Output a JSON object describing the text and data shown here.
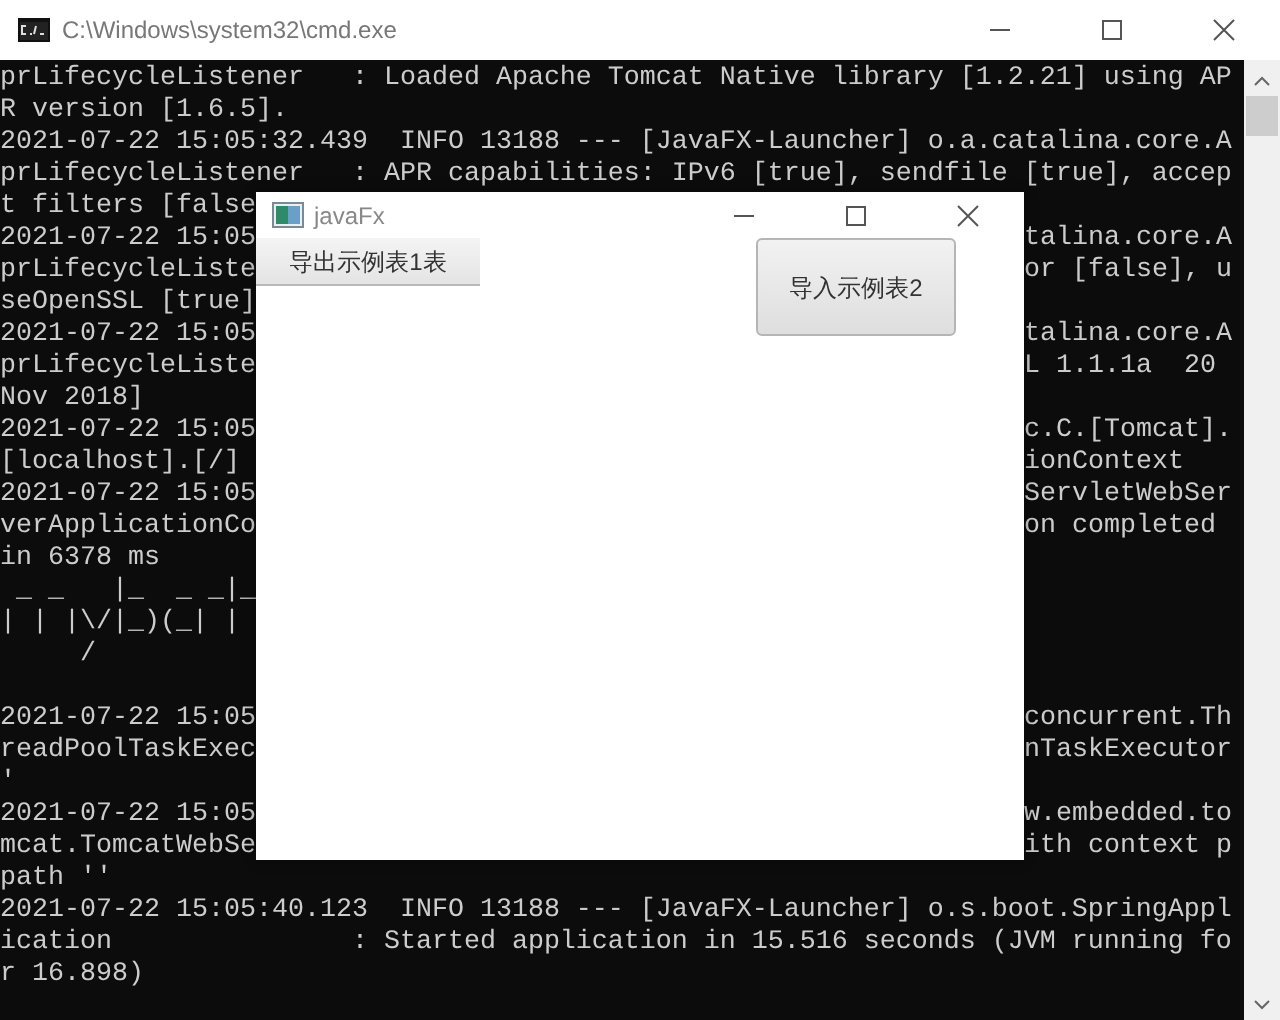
{
  "console_window": {
    "title": "C:\\Windows\\system32\\cmd.exe",
    "lines": [
      {
        "kind": "text",
        "text": "prLifecycleListener   : Loaded Apache Tomcat Native library [1.2.21] using AP"
      },
      {
        "kind": "text",
        "text": "R version [1.6.5]."
      },
      {
        "kind": "text",
        "text": "2021-07-22 15:05:32.439  INFO 13188 --- [JavaFX-Launcher] o.a.catalina.core.A"
      },
      {
        "kind": "text",
        "text": "prLifecycleListener   : APR capabilities: IPv6 [true], sendfile [true], accep"
      },
      {
        "kind": "split",
        "left": "t filters [false"
      },
      {
        "kind": "split",
        "left": "2021-07-22 15:05",
        "right": "talina.core.A"
      },
      {
        "kind": "split",
        "left": "prLifecycleListe",
        "right": "or [false], u"
      },
      {
        "kind": "split",
        "left": "seOpenSSL [true]"
      },
      {
        "kind": "split",
        "left": "2021-07-22 15:05",
        "right": "talina.core.A"
      },
      {
        "kind": "split",
        "left": "prLifecycleListe",
        "right": "L 1.1.1a  20"
      },
      {
        "kind": "split",
        "left": "Nov 2018]"
      },
      {
        "kind": "split",
        "left": "2021-07-22 15:05",
        "right": "c.C.[Tomcat]."
      },
      {
        "kind": "split",
        "left": "[localhost].[/]",
        "right": "ionContext"
      },
      {
        "kind": "split",
        "left": "2021-07-22 15:05",
        "right": "ServletWebSer"
      },
      {
        "kind": "split",
        "left": "verApplicationCo",
        "right": "on completed"
      },
      {
        "kind": "split",
        "left": "in 6378 ms"
      },
      {
        "kind": "split",
        "left": " _ _   |_  _ _|_"
      },
      {
        "kind": "split",
        "left": "| | |\\/|_)(_| | "
      },
      {
        "kind": "split",
        "left": "     /"
      },
      {
        "kind": "blank"
      },
      {
        "kind": "split",
        "left": "2021-07-22 15:05",
        "right": "concurrent.Th"
      },
      {
        "kind": "split",
        "left": "readPoolTaskExec",
        "right": "nTaskExecutor"
      },
      {
        "kind": "split",
        "left": "'"
      },
      {
        "kind": "split",
        "left": "2021-07-22 15:05",
        "right": "w.embedded.to"
      },
      {
        "kind": "split",
        "left": "mcat.TomcatWebSe",
        "right": "ith context p"
      },
      {
        "kind": "text",
        "text": "path ''"
      },
      {
        "kind": "text",
        "text": "2021-07-22 15:05:40.123  INFO 13188 --- [JavaFX-Launcher] o.s.boot.SpringAppl"
      },
      {
        "kind": "text",
        "text": "ication               : Started application in 15.516 seconds (JVM running fo"
      },
      {
        "kind": "text",
        "text": "r 16.898)"
      }
    ]
  },
  "javafx_window": {
    "title": "javaFx",
    "buttons": [
      {
        "label": "导出示例表1表",
        "kind": "flat"
      },
      {
        "label": "导入示例表2",
        "kind": "raised"
      }
    ]
  }
}
